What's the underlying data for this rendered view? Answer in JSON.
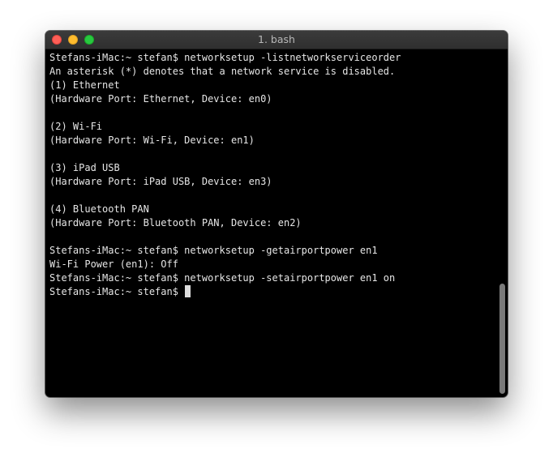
{
  "window": {
    "title": "1. bash"
  },
  "terminal": {
    "lines": [
      "Stefans-iMac:~ stefan$ networksetup -listnetworkserviceorder",
      "An asterisk (*) denotes that a network service is disabled.",
      "(1) Ethernet",
      "(Hardware Port: Ethernet, Device: en0)",
      "",
      "(2) Wi-Fi",
      "(Hardware Port: Wi-Fi, Device: en1)",
      "",
      "(3) iPad USB",
      "(Hardware Port: iPad USB, Device: en3)",
      "",
      "(4) Bluetooth PAN",
      "(Hardware Port: Bluetooth PAN, Device: en2)",
      "",
      "Stefans-iMac:~ stefan$ networksetup -getairportpower en1",
      "Wi-Fi Power (en1): Off",
      "Stefans-iMac:~ stefan$ networksetup -setairportpower en1 on",
      "Stefans-iMac:~ stefan$ "
    ]
  }
}
